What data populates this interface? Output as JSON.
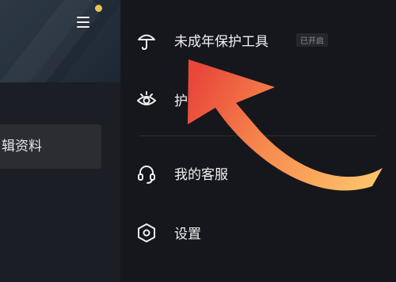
{
  "left_panel": {
    "edit_profile_label": "辑资料"
  },
  "menu": {
    "items": [
      {
        "label": "未成年保护工具",
        "icon": "umbrella-icon",
        "badge": "已开启"
      },
      {
        "label": "护眼",
        "icon": "eye-icon"
      },
      {
        "label": "我的客服",
        "icon": "headset-icon"
      },
      {
        "label": "设置",
        "icon": "hexagon-gear-icon"
      }
    ]
  },
  "colors": {
    "background": "#16171c",
    "left_panel": "#1c1e25",
    "notification_dot": "#e8c451",
    "arrow_start": "#ffc36a",
    "arrow_end": "#e9473a"
  }
}
